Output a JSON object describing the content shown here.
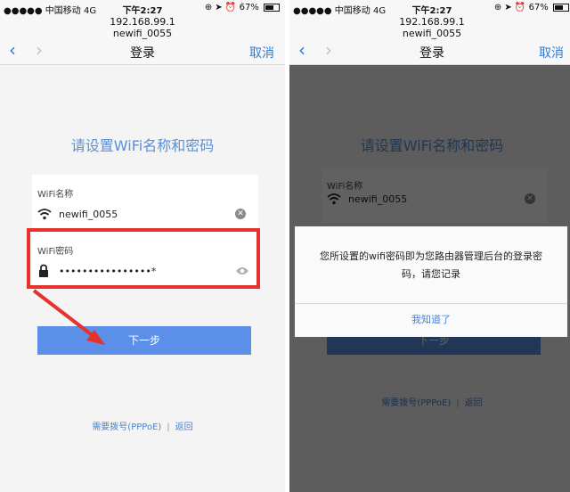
{
  "status": {
    "carrier": "●●●●● 中国移动  4G",
    "time": "下午2:27",
    "battery": "67%",
    "battery_level": 0.67
  },
  "nav": {
    "url": "192.168.99.1",
    "page_host": "newifi_0055",
    "title": "登录",
    "cancel": "取消",
    "back_icon": "chevron-left-icon",
    "forward_icon": "chevron-right-icon"
  },
  "form": {
    "heading": "请设置WiFi名称和密码",
    "wifi_name_label": "WiFi名称",
    "wifi_name_value": "newifi_0055",
    "wifi_password_label": "WiFi密码",
    "wifi_password_value": "••••••••••••••••*",
    "next_button": "下一步"
  },
  "footer": {
    "pppoe_link": "需要拨号(PPPoE)",
    "separator": "|",
    "back_link": "返回"
  },
  "dialog": {
    "message": "您所设置的wifi密码即为您路由器管理后台的登录密码，请您记录",
    "confirm": "我知道了"
  },
  "colors": {
    "accent": "#2f7bd8",
    "button": "#5b8fe8",
    "highlight": "#e5322d"
  }
}
